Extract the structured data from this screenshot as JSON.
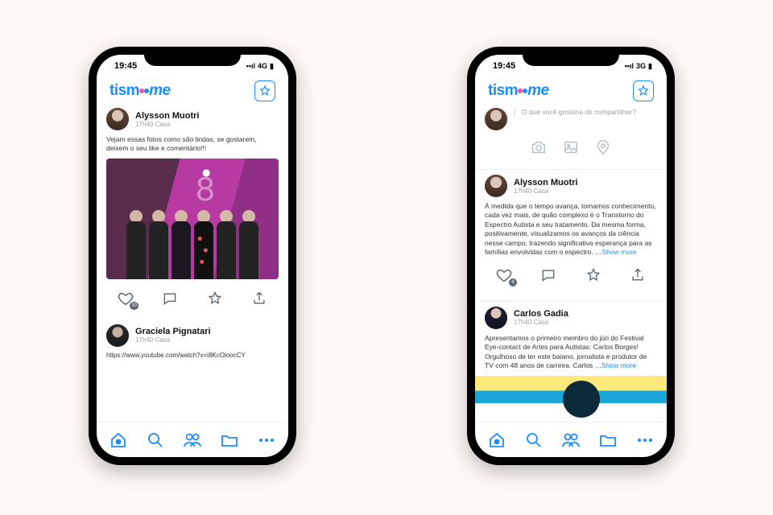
{
  "status": {
    "time": "19:45",
    "net_left": "4G",
    "net_right": "3G",
    "signal_glyph": "▬◦◦",
    "batt": "■"
  },
  "brand": {
    "prefix": "tism",
    "suffix": "me"
  },
  "left": {
    "post1": {
      "author": "Alysson Muotri",
      "meta": "17h40  Casa",
      "text": "Vejam essas fotos como são lindas, se gostarem, deixem o seu like e comentário!!!",
      "like_count": "30"
    },
    "post2": {
      "author": "Graciela Pignatari",
      "meta": "17h40  Casa",
      "link": "https://www.youtube.com/watch?v=i8KcOloocCY"
    }
  },
  "right": {
    "compose_placeholder": "O que você gostaria de compartilhar?",
    "post1": {
      "author": "Alysson Muotri",
      "meta": "17h40  Casa",
      "text": "À medida que o tempo avança, tomamos conhecimento, cada vez mais, de quão complexo é o Transtorno do Espectro Autista e seu tratamento.\nDa mesma forma, positivamente, visualizamos os avanços da ciência nesse campo, trazendo significativa esperança para as famílias envolvidas com o espectro. …",
      "more": "Show more",
      "like_count": "6"
    },
    "post2": {
      "author": "Carlos Gadia",
      "meta": "17h40  Casa",
      "text": "Apresentamos o primeiro membro do júri do Festival Eye-contact de Artes para Autistas: Carlos Borges! Orgulhoso de ter este baiano, jornalista e produtor de TV com 48 anos de carreira. Carlos …",
      "more": "Show more"
    }
  }
}
